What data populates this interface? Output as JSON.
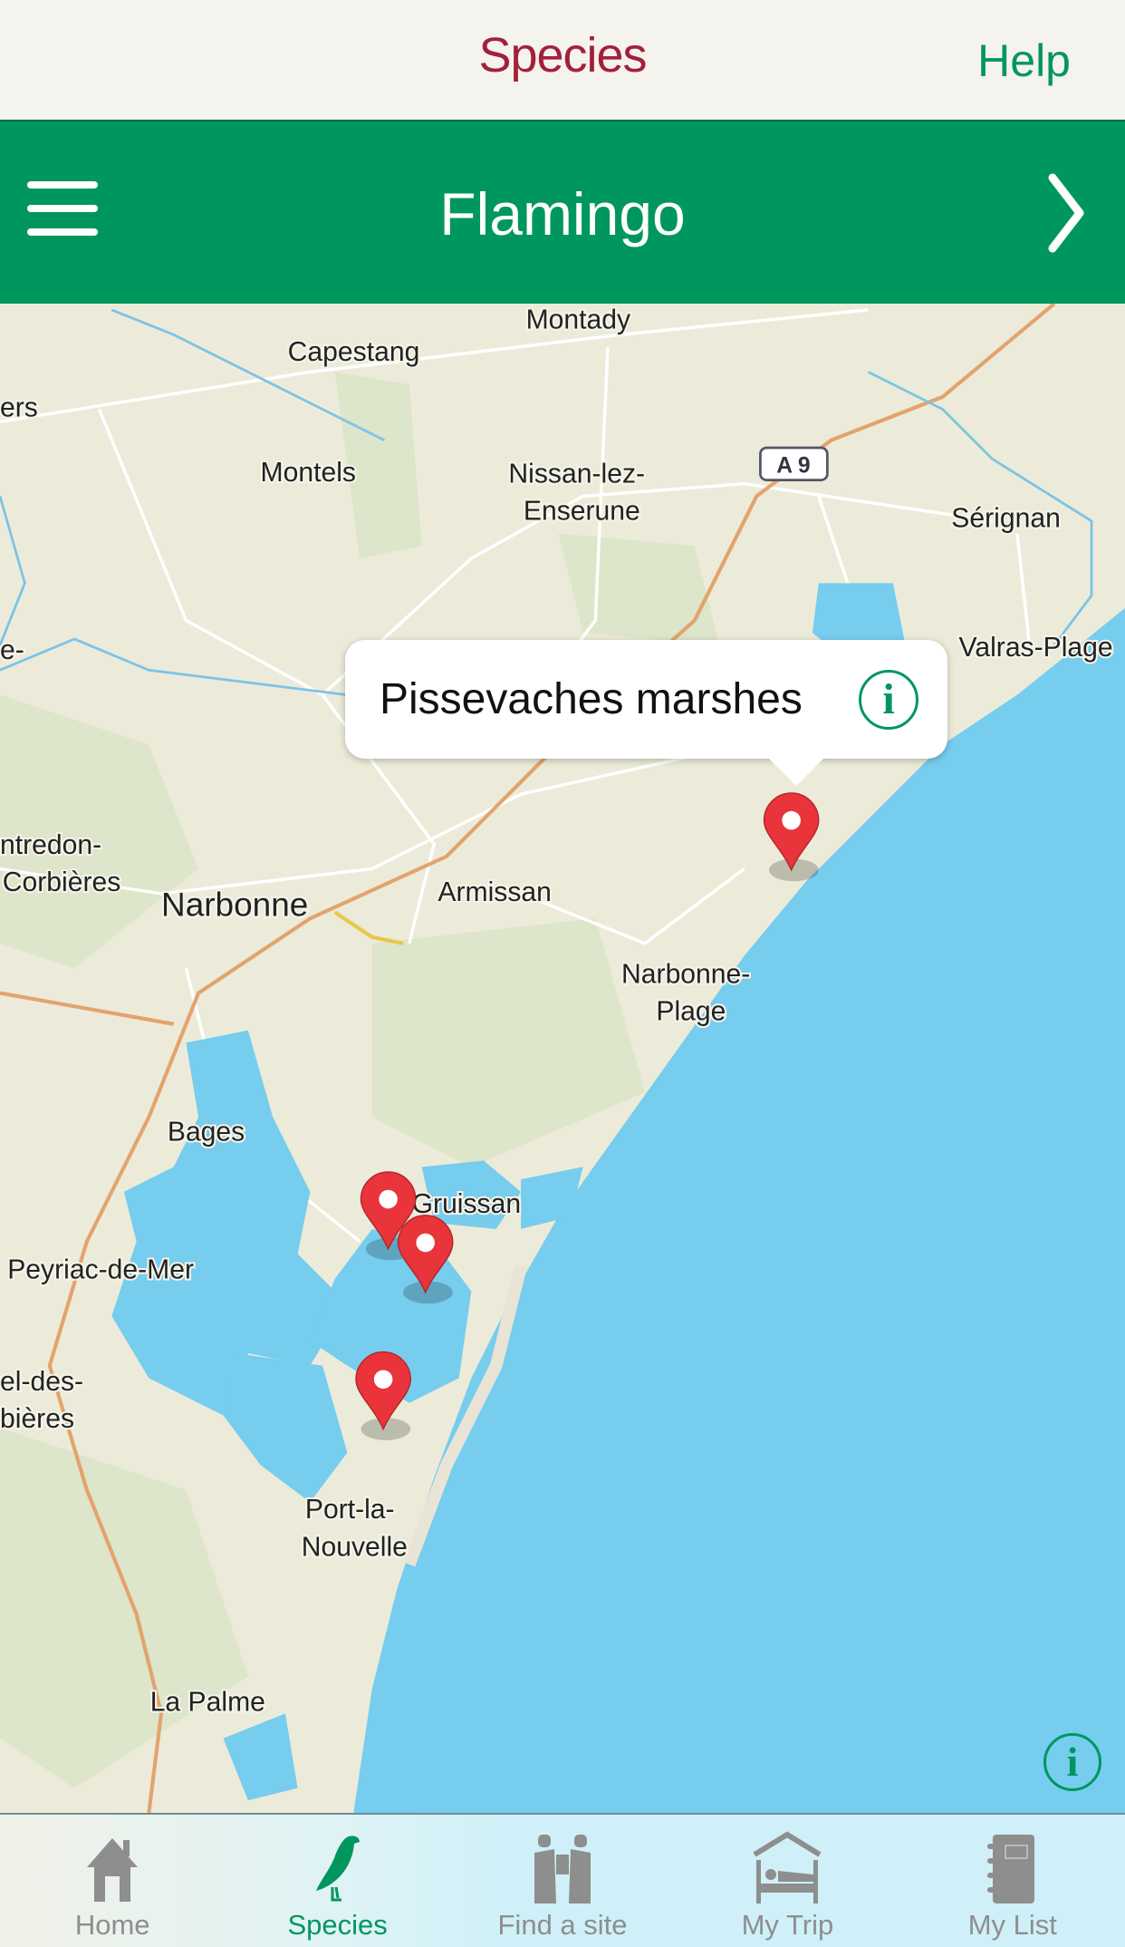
{
  "top_bar": {
    "title": "Species",
    "help_label": "Help"
  },
  "header": {
    "species_name": "Flamingo",
    "menu_icon": "hamburger-icon",
    "next_icon": "chevron-right-icon"
  },
  "map": {
    "labels": {
      "montady": "Montady",
      "capestang": "Capestang",
      "ers": "ers",
      "montels": "Montels",
      "nissan1": "Nissan-lez-",
      "nissan2": "Enserune",
      "a9": "A 9",
      "serignan": "Sérignan",
      "valras": "Valras-Plage",
      "e": "e-",
      "fontredon1": "ntredon-",
      "fontredon2": "Corbières",
      "narbonne": "Narbonne",
      "armissan": "Armissan",
      "nplage1": "Narbonne-",
      "nplage2": "Plage",
      "bages": "Bages",
      "gruissan": "Gruissan",
      "peyriac": "Peyriac-de-Mer",
      "sigean1": "el-des-",
      "sigean2": "bières",
      "port1": "Port-la-",
      "port2": "Nouvelle",
      "lapalme": "La Palme"
    },
    "popup": {
      "title": "Pissevaches marshes",
      "icon": "info-icon"
    },
    "pins_count": 4,
    "colors": {
      "sea": "#76cdee",
      "land": "#ecebd9",
      "pin": "#e8343a"
    }
  },
  "tabs": [
    {
      "label": "Home",
      "icon": "home-icon",
      "active": false
    },
    {
      "label": "Species",
      "icon": "bird-icon",
      "active": true
    },
    {
      "label": "Find a site",
      "icon": "binoculars-icon",
      "active": false
    },
    {
      "label": "My Trip",
      "icon": "bed-icon",
      "active": false
    },
    {
      "label": "My List",
      "icon": "notebook-icon",
      "active": false
    }
  ],
  "colors": {
    "accent_green": "#00975f",
    "title_red": "#a3203a",
    "inactive_grey": "#8e8e8e"
  }
}
